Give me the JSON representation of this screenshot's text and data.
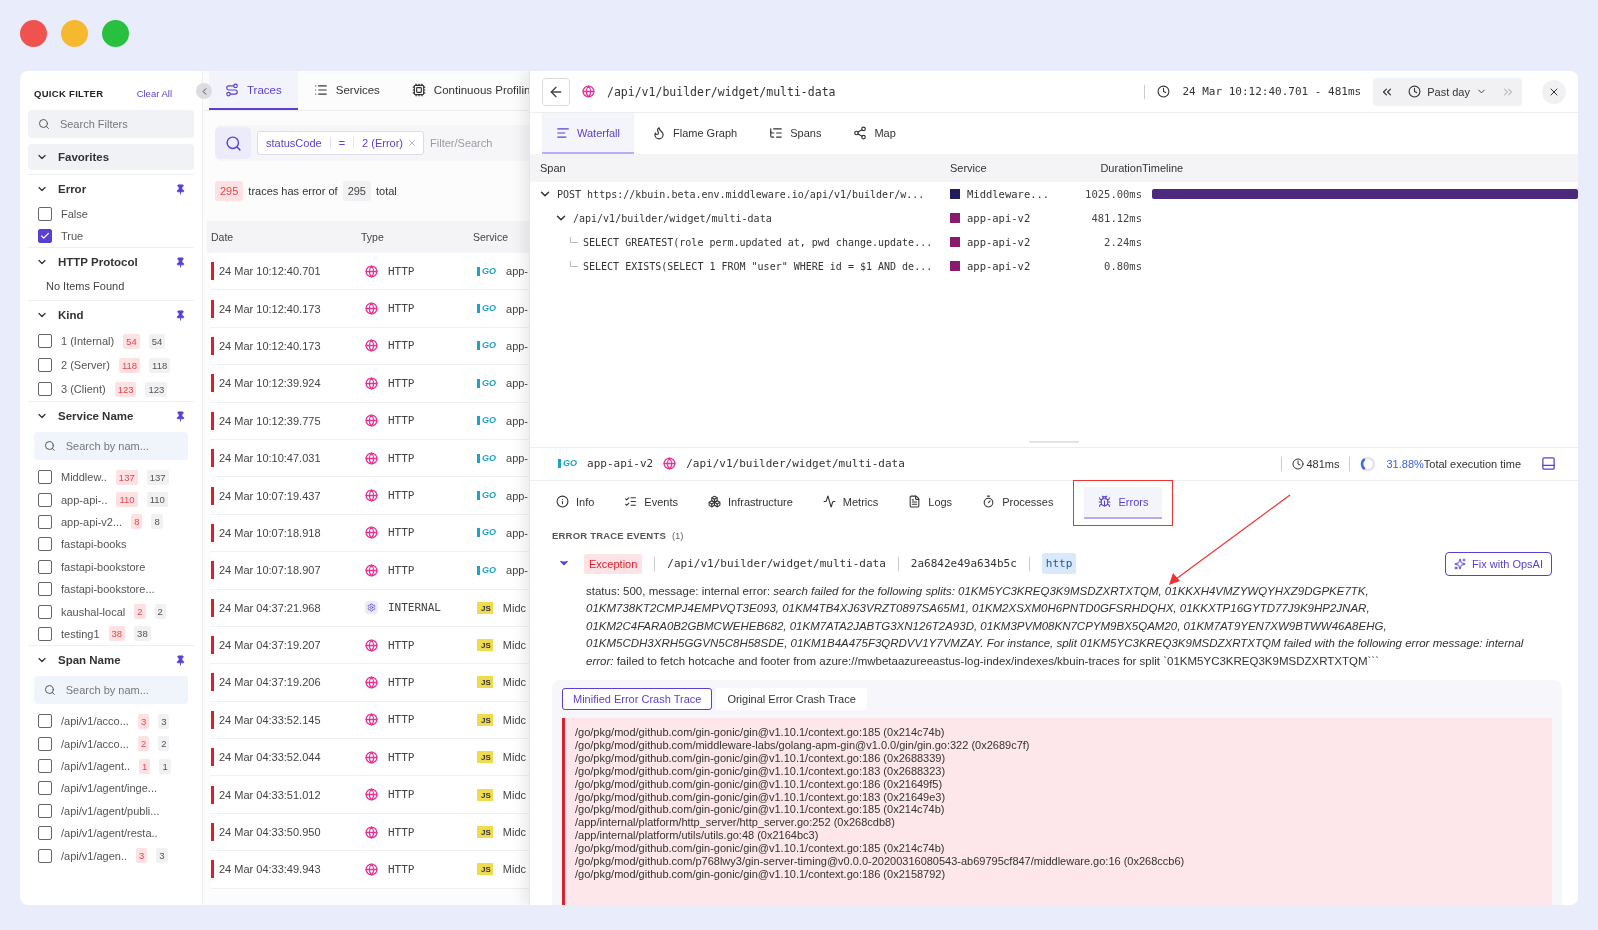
{
  "sidebar": {
    "title": "QUICK FILTER",
    "clear_link": "Clear All",
    "search_placeholder": "Search Filters",
    "favorites": {
      "label": "Favorites",
      "expanded": true
    },
    "sections": [
      {
        "kind": "checklist",
        "title": "Error",
        "pinned": true,
        "expanded": true,
        "items": [
          {
            "label": "False",
            "checked": false
          },
          {
            "label": "True",
            "checked": true
          }
        ]
      },
      {
        "kind": "empty",
        "title": "HTTP Protocol",
        "pinned": true,
        "expanded": true,
        "message": "No Items Found"
      },
      {
        "kind": "checklist",
        "title": "Kind",
        "pinned": true,
        "expanded": true,
        "items": [
          {
            "label": "1 (Internal)",
            "checked": false,
            "error_count": "54",
            "total": "54"
          },
          {
            "label": "2 (Server)",
            "checked": false,
            "error_count": "118",
            "total": "118"
          },
          {
            "label": "3 (Client)",
            "checked": false,
            "error_count": "123",
            "total": "123"
          }
        ]
      },
      {
        "kind": "search",
        "title": "Service Name",
        "pinned": true,
        "expanded": true,
        "placeholder": "Search by nam...",
        "items": [
          {
            "label": "Middlew..",
            "checked": false,
            "error_count": "137",
            "total": "137"
          },
          {
            "label": "app-api-..",
            "checked": false,
            "error_count": "110",
            "total": "110"
          },
          {
            "label": "app-api-v2...",
            "checked": false,
            "error_count": "8",
            "total": "8"
          },
          {
            "label": "fastapi-books",
            "checked": false
          },
          {
            "label": "fastapi-bookstore",
            "checked": false
          },
          {
            "label": "fastapi-bookstore...",
            "checked": false
          },
          {
            "label": "kaushal-local",
            "checked": false,
            "error_count": "2",
            "total": "2"
          },
          {
            "label": "testing1",
            "checked": false,
            "error_count": "38",
            "total": "38"
          }
        ]
      },
      {
        "kind": "search",
        "title": "Span Name",
        "pinned": true,
        "expanded": true,
        "placeholder": "Search by nam...",
        "items": [
          {
            "label": "/api/v1/acco...",
            "checked": false,
            "error_count": "3",
            "total": "3"
          },
          {
            "label": "/api/v1/acco...",
            "checked": false,
            "error_count": "2",
            "total": "2"
          },
          {
            "label": "/api/v1/agent..",
            "checked": false,
            "error_count": "1",
            "total": "1"
          },
          {
            "label": "/api/v1/agent/inge...",
            "checked": false
          },
          {
            "label": "/api/v1/agent/publi...",
            "checked": false
          },
          {
            "label": "/api/v1/agent/resta..",
            "checked": false
          },
          {
            "label": "/api/v1/agen..",
            "checked": false,
            "error_count": "3",
            "total": "3"
          }
        ]
      }
    ]
  },
  "traces": {
    "tabs": [
      {
        "label": "Traces",
        "selected": true
      },
      {
        "label": "Services",
        "selected": false
      },
      {
        "label": "Continuous Profilin",
        "selected": false
      }
    ],
    "filter": {
      "field": "statusCode",
      "operator": "=",
      "value": "2 (Error)",
      "placeholder": "Filter/Search"
    },
    "summary": {
      "error_count": "295",
      "text": "traces has error of",
      "total": "295",
      "suffix": "total"
    },
    "columns": [
      "Date",
      "Type",
      "Service"
    ],
    "rows": [
      {
        "date": "24 Mar 10:12:40.701",
        "kind": "http",
        "type": "HTTP",
        "logo": {
          "kind": "plain",
          "text": "GO",
          "color": "#1aa3c9"
        },
        "service": "app-",
        "error": true
      },
      {
        "date": "24 Mar 10:12:40.173",
        "kind": "http",
        "type": "HTTP",
        "logo": {
          "kind": "plain",
          "text": "GO",
          "color": "#1aa3c9"
        },
        "service": "app-",
        "error": true
      },
      {
        "date": "24 Mar 10:12:40.173",
        "kind": "http",
        "type": "HTTP",
        "logo": {
          "kind": "plain",
          "text": "GO",
          "color": "#1aa3c9"
        },
        "service": "app-",
        "error": true
      },
      {
        "date": "24 Mar 10:12:39.924",
        "kind": "http",
        "type": "HTTP",
        "logo": {
          "kind": "plain",
          "text": "GO",
          "color": "#1aa3c9"
        },
        "service": "app-",
        "error": true
      },
      {
        "date": "24 Mar 10:12:39.775",
        "kind": "http",
        "type": "HTTP",
        "logo": {
          "kind": "plain",
          "text": "GO",
          "color": "#1aa3c9"
        },
        "service": "app-",
        "error": true
      },
      {
        "date": "24 Mar 10:10:47.031",
        "kind": "http",
        "type": "HTTP",
        "logo": {
          "kind": "plain",
          "text": "GO",
          "color": "#1aa3c9"
        },
        "service": "app-",
        "error": true
      },
      {
        "date": "24 Mar 10:07:19.437",
        "kind": "http",
        "type": "HTTP",
        "logo": {
          "kind": "plain",
          "text": "GO",
          "color": "#1aa3c9"
        },
        "service": "app-",
        "error": true
      },
      {
        "date": "24 Mar 10:07:18.918",
        "kind": "http",
        "type": "HTTP",
        "logo": {
          "kind": "plain",
          "text": "GO",
          "color": "#1aa3c9"
        },
        "service": "app-",
        "error": true
      },
      {
        "date": "24 Mar 10:07:18.907",
        "kind": "http",
        "type": "HTTP",
        "logo": {
          "kind": "plain",
          "text": "GO",
          "color": "#1aa3c9"
        },
        "service": "app-",
        "error": true
      },
      {
        "date": "24 Mar 04:37:21.968",
        "kind": "internal",
        "type": "INTERNAL",
        "logo": {
          "kind": "tile",
          "text": "JS",
          "color": "#f0db4f"
        },
        "service": "Midc",
        "error": true
      },
      {
        "date": "24 Mar 04:37:19.207",
        "kind": "http",
        "type": "HTTP",
        "logo": {
          "kind": "tile",
          "text": "JS",
          "color": "#f0db4f"
        },
        "service": "Midc",
        "error": true
      },
      {
        "date": "24 Mar 04:37:19.206",
        "kind": "http",
        "type": "HTTP",
        "logo": {
          "kind": "tile",
          "text": "JS",
          "color": "#f0db4f"
        },
        "service": "Midc",
        "error": true
      },
      {
        "date": "24 Mar 04:33:52.145",
        "kind": "http",
        "type": "HTTP",
        "logo": {
          "kind": "tile",
          "text": "JS",
          "color": "#f0db4f"
        },
        "service": "Midc",
        "error": true
      },
      {
        "date": "24 Mar 04:33:52.044",
        "kind": "http",
        "type": "HTTP",
        "logo": {
          "kind": "tile",
          "text": "JS",
          "color": "#f0db4f"
        },
        "service": "Midc",
        "error": true
      },
      {
        "date": "24 Mar 04:33:51.012",
        "kind": "http",
        "type": "HTTP",
        "logo": {
          "kind": "tile",
          "text": "JS",
          "color": "#f0db4f"
        },
        "service": "Midc",
        "error": true
      },
      {
        "date": "24 Mar 04:33:50.950",
        "kind": "http",
        "type": "HTTP",
        "logo": {
          "kind": "tile",
          "text": "JS",
          "color": "#f0db4f"
        },
        "service": "Midc",
        "error": true
      },
      {
        "date": "24 Mar 04:33:49.943",
        "kind": "http",
        "type": "HTTP",
        "logo": {
          "kind": "tile",
          "text": "JS",
          "color": "#f0db4f"
        },
        "service": "Midc",
        "error": true
      }
    ]
  },
  "detail": {
    "path": "/api/v1/builder/widget/multi-data",
    "time": "24 Mar 10:12:40.701 - 481ms",
    "range": "Past day",
    "next_disabled": true,
    "tabs": [
      {
        "label": "Waterfall",
        "selected": true
      },
      {
        "label": "Flame Graph",
        "selected": false
      },
      {
        "label": "Spans",
        "selected": false
      },
      {
        "label": "Map",
        "selected": false
      }
    ],
    "span_columns": [
      "Span",
      "Service",
      "Duration",
      "Timeline"
    ],
    "spans": [
      {
        "name": "POST https://kbuin.beta.env.middleware.io/api/v1/builder/w...",
        "service": "Middleware...",
        "color": "#1f1b5c",
        "duration": "1025.00ms",
        "level": 1,
        "expanded": true,
        "children": [
          {
            "name": "/api/v1/builder/widget/multi-data",
            "service": "app-api-v2",
            "color": "#8a1a6e",
            "duration": "481.12ms",
            "expanded": true,
            "children": [
              {
                "name": "SELECT GREATEST(role_perm.updated_at, pwd_change.update...",
                "service": "app-api-v2",
                "color": "#8a1a6e",
                "duration": "2.24ms"
              },
              {
                "name": "SELECT EXISTS(SELECT 1 FROM \"user\" WHERE id = $1 AND de...",
                "service": "app-api-v2",
                "color": "#8a1a6e",
                "duration": "0.80ms"
              }
            ]
          }
        ]
      }
    ],
    "span_summary": {
      "logo": {
        "kind": "plain",
        "text": "GO",
        "color": "#1aa3c9"
      },
      "service": "app-api-v2",
      "path": "/api/v1/builder/widget/multi-data",
      "duration": "481ms",
      "percent": "31.88%",
      "percent_label": "Total execution time",
      "level": 0.3188
    },
    "info_tabs": [
      {
        "label": "Info",
        "selected": false
      },
      {
        "label": "Events",
        "selected": false
      },
      {
        "label": "Infrastructure",
        "selected": false
      },
      {
        "label": "Metrics",
        "selected": false
      },
      {
        "label": "Logs",
        "selected": false
      },
      {
        "label": "Processes",
        "selected": false
      },
      {
        "label": "Errors",
        "selected": true
      }
    ],
    "events_title": "ERROR TRACE EVENTS",
    "events_count": "(1)",
    "exception": {
      "expanded": true,
      "label": "Exception",
      "path": "/api/v1/builder/widget/multi-data",
      "id": "2a6842e49a634b5c",
      "protocol": "http",
      "fix_button": "Fix with OpsAI",
      "message": "status: 500, message: internal error: *search failed for the following splits: 01KM5YC3KREQ3K9MSDZXRTXTQM, 01KKXH4VMZYWQYHXZ9DGPKE7TK, 01KM738KT2CMPJ4EMPVQT3E093, 01KM4TB4XJ63VRZT0897SA65M1, 01KM2XSXM0H6PNTD0GFSRHDQHX, 01KKXTP16GYTD77J9K9HP2JNAR, 01KM2C4FARA0B2GBMCWEHEB682, 01KM7ATA2JABTG3XN126T2A93D, 01KM3PVM08KN7CPYM9BX5QAM20, 01KM7AT9YEN7XW9BTWW46A8EHG, 01KM5CDH3XRH5GGVN5C8H58SDE, 01KM1B4A475F3QRDVV1Y7VMZAY. For instance, split 01KM5YC3KREQ3K9MSDZXRTXTQM failed with the following error message: internal error:* failed to fetch hotcache and footer from azure://mwbetaazureeastus-log-index/indexes/kbuin-traces for split `01KM5YC3KREQ3K9MSDZXRTXTQM```"
    },
    "crash_tabs": [
      {
        "label": "Minified Error Crash Trace",
        "selected": true
      },
      {
        "label": "Original Error Crash Trace",
        "selected": false
      }
    ],
    "stack": [
      "/go/pkg/mod/github.com/gin-gonic/gin@v1.10.1/context.go:185 (0x214c74b)",
      "/go/pkg/mod/github.com/middleware-labs/golang-apm-gin@v1.0.0/gin/gin.go:322 (0x2689c7f)",
      "/go/pkg/mod/github.com/gin-gonic/gin@v1.10.1/context.go:186 (0x2688339)",
      "/go/pkg/mod/github.com/gin-gonic/gin@v1.10.1/context.go:183 (0x2688323)",
      "/go/pkg/mod/github.com/gin-gonic/gin@v1.10.1/context.go:186 (0x21649f5)",
      "/go/pkg/mod/github.com/gin-gonic/gin@v1.10.1/context.go:183 (0x21649e3)",
      "/go/pkg/mod/github.com/gin-gonic/gin@v1.10.1/context.go:185 (0x214c74b)",
      "/app/internal/platform/http_server/http_server.go:252 (0x268cdb8)",
      "/app/internal/platform/utils/utils.go:48 (0x2164bc3)",
      "/go/pkg/mod/github.com/gin-gonic/gin@v1.10.1/context.go:185 (0x214c74b)",
      "/go/pkg/mod/github.com/p768lwy3/gin-server-timing@v0.0.0-20200316080543-ab69795cf847/middleware.go:16 (0x268ccb6)",
      "/go/pkg/mod/github.com/gin-gonic/gin@v1.10.1/context.go:186 (0x2158792)"
    ]
  }
}
